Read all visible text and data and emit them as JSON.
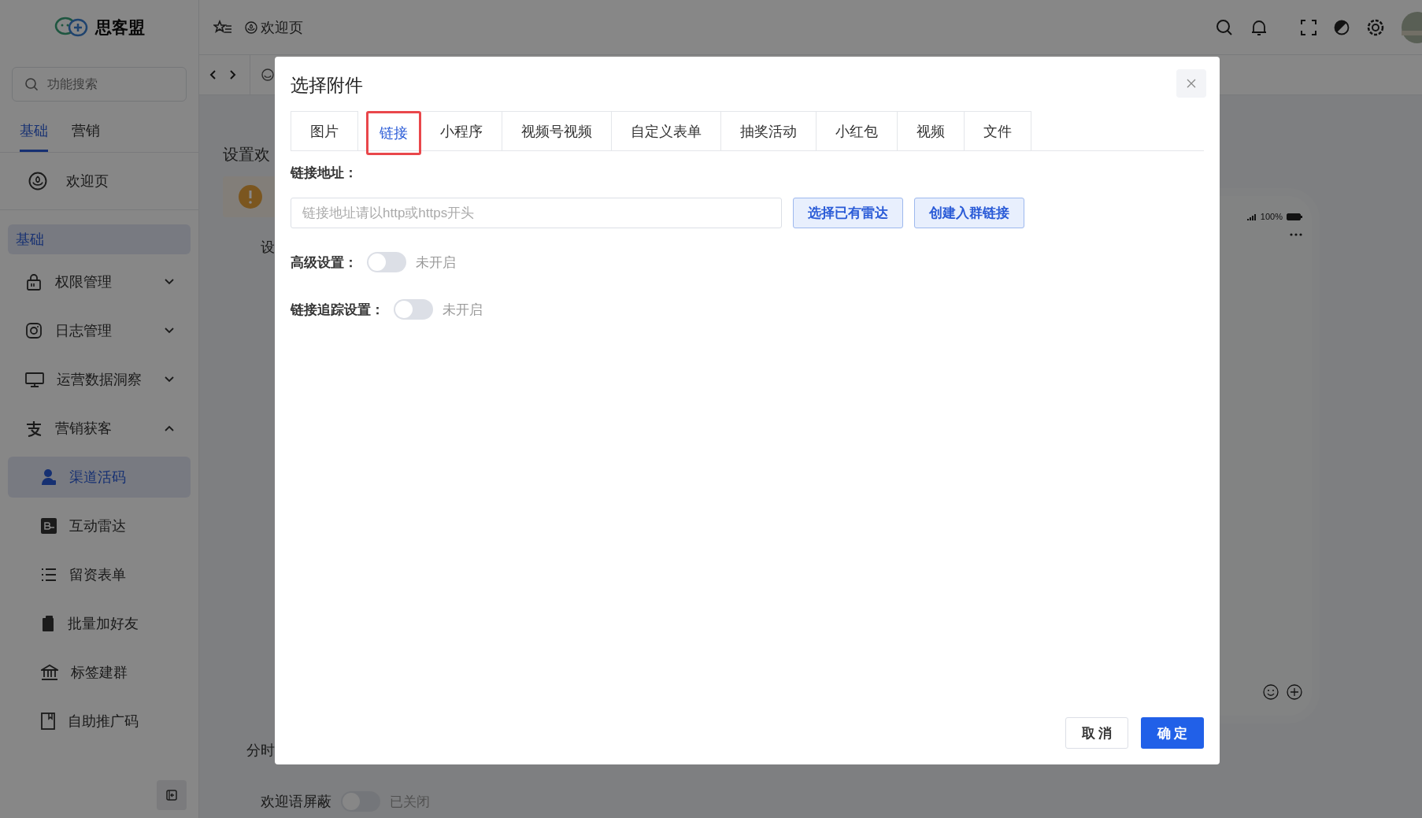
{
  "app": {
    "logo_text": "思客盟"
  },
  "sidebar": {
    "search": {
      "placeholder": "功能搜索"
    },
    "tabs": [
      {
        "label": "基础",
        "selected": true
      },
      {
        "label": "营销",
        "selected": false
      }
    ],
    "home_item": {
      "label": "欢迎页"
    },
    "group_label": "基础",
    "menu": [
      {
        "label": "权限管理",
        "expanded": false
      },
      {
        "label": "日志管理",
        "expanded": false
      },
      {
        "label": "运营数据洞察",
        "expanded": false
      },
      {
        "label": "营销获客",
        "expanded": true,
        "children": [
          {
            "label": "渠道活码",
            "selected": true
          },
          {
            "label": "互动雷达",
            "selected": false
          },
          {
            "label": "留资表单",
            "selected": false
          },
          {
            "label": "批量加好友",
            "selected": false
          },
          {
            "label": "标签建群",
            "selected": false
          },
          {
            "label": "自助推广码",
            "selected": false
          }
        ]
      }
    ]
  },
  "header": {
    "page_title": "欢迎页"
  },
  "background": {
    "page_title": "设置欢",
    "row_label": "设",
    "section_label": "分时",
    "mute_label": "欢迎语屏蔽",
    "mute_toggle": {
      "on": false
    },
    "mute_status": "已关闭",
    "phone": {
      "battery": "100%"
    }
  },
  "dialog": {
    "title": "选择附件",
    "tabs": [
      {
        "label": "图片",
        "selected": false
      },
      {
        "label": "链接",
        "selected": true
      },
      {
        "label": "小程序",
        "selected": false
      },
      {
        "label": "视频号视频",
        "selected": false
      },
      {
        "label": "自定义表单",
        "selected": false
      },
      {
        "label": "抽奖活动",
        "selected": false
      },
      {
        "label": "小红包",
        "selected": false
      },
      {
        "label": "视频",
        "selected": false
      },
      {
        "label": "文件",
        "selected": false
      }
    ],
    "url_label": "链接地址：",
    "url_field": {
      "placeholder": "链接地址请以http或https开头"
    },
    "actions": [
      "选择已有雷达",
      "创建入群链接"
    ],
    "settings": [
      {
        "label": "高级设置：",
        "on": false,
        "status": "未开启"
      },
      {
        "label": "链接追踪设置：",
        "on": false,
        "status": "未开启"
      }
    ],
    "footer": {
      "cancel": "取 消",
      "confirm": "确 定"
    }
  }
}
